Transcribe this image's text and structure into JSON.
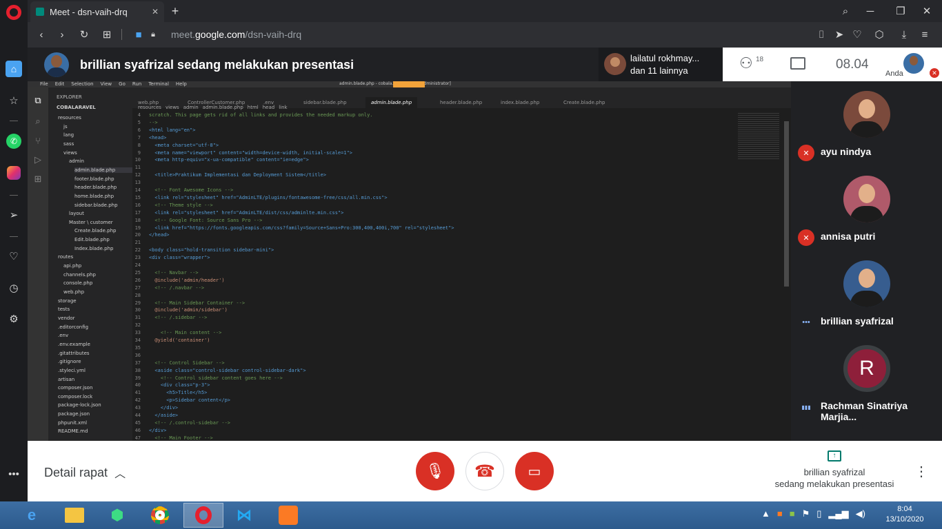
{
  "browser": {
    "tab_title": "Meet - dsn-vaih-drq",
    "address_prefix": "meet.",
    "address_domain": "google.com",
    "address_path": "/dsn-vaih-drq"
  },
  "meet": {
    "presenter_banner": "brillian syafrizal sedang melakukan presentasi",
    "others_name": "lailatul rokhmay...",
    "others_more": "dan 11 lainnya",
    "participants_count": "18",
    "time": "08.04",
    "self_label": "Anda",
    "participants": [
      {
        "name": "ayu nindya"
      },
      {
        "name": "annisa putri"
      },
      {
        "name": "brillian syafrizal"
      },
      {
        "name": "Rachman Sinatriya Marjia...",
        "initial": "R"
      }
    ],
    "details_label": "Detail rapat",
    "presenting_line1": "brillian syafrizal",
    "presenting_line2": "sedang melakukan presentasi"
  },
  "vscode": {
    "window_title": "admin.blade.php - cobala... udio Code [Administrator]",
    "menu": [
      "File",
      "Edit",
      "Selection",
      "View",
      "Go",
      "Run",
      "Terminal",
      "Help"
    ],
    "explorer_title": "EXPLORER",
    "project": "COBALARAVEL",
    "tabs": [
      "web.php",
      "ControllerCustomer.php",
      ".env",
      "sidebar.blade.php",
      "admin.blade.php",
      "header.blade.php",
      "index.blade.php",
      "Create.blade.php"
    ],
    "breadcrumb": [
      "resources",
      "views",
      "admin",
      "admin.blade.php",
      "html",
      "head",
      "link"
    ],
    "tree": [
      "resources",
      "js",
      "lang",
      "sass",
      "views",
      "admin",
      "admin.blade.php",
      "footer.blade.php",
      "header.blade.php",
      "home.blade.php",
      "sidebar.blade.php",
      "layout",
      "Master \\ customer",
      "Create.blade.php",
      "Edit.blade.php",
      "Index.blade.php",
      "routes",
      "api.php",
      "channels.php",
      "console.php",
      "web.php",
      "storage",
      "tests",
      "vendor",
      ".editorconfig",
      ".env",
      ".env.example",
      ".gitattributes",
      ".gitignore",
      ".styleci.yml",
      "artisan",
      "composer.json",
      "composer.lock",
      "package-lock.json",
      "package.json",
      "phpunit.xml",
      "README.md"
    ],
    "code": [
      {
        "n": "4",
        "t": "scratch. This page gets rid of all links and provides the needed markup only."
      },
      {
        "n": "5",
        "t": "-->"
      },
      {
        "n": "6",
        "t": "<html lang=\"en\">"
      },
      {
        "n": "7",
        "t": "<head>"
      },
      {
        "n": "8",
        "t": "  <meta charset=\"utf-8\">"
      },
      {
        "n": "9",
        "t": "  <meta name=\"viewport\" content=\"width=device-width, initial-scale=1\">"
      },
      {
        "n": "10",
        "t": "  <meta http-equiv=\"x-ua-compatible\" content=\"ie=edge\">"
      },
      {
        "n": "11",
        "t": ""
      },
      {
        "n": "12",
        "t": "  <title>Praktikum Implementasi dan Deployment Sistem</title>"
      },
      {
        "n": "13",
        "t": ""
      },
      {
        "n": "14",
        "t": "  <!-- Font Awesome Icons -->"
      },
      {
        "n": "15",
        "t": "  <link rel=\"stylesheet\" href=\"AdminLTE/plugins/fontawesome-free/css/all.min.css\">"
      },
      {
        "n": "16",
        "t": "  <!-- Theme style -->"
      },
      {
        "n": "17",
        "t": "  <link rel=\"stylesheet\" href=\"AdminLTE/dist/css/adminlte.min.css\">"
      },
      {
        "n": "18",
        "t": "  <!-- Google Font: Source Sans Pro -->"
      },
      {
        "n": "19",
        "t": "  <link href=\"https://fonts.googleapis.com/css?family=Source+Sans+Pro:300,400,400i,700\" rel=\"stylesheet\">"
      },
      {
        "n": "20",
        "t": "</head>"
      },
      {
        "n": "21",
        "t": ""
      },
      {
        "n": "22",
        "t": "<body class=\"hold-transition sidebar-mini\">"
      },
      {
        "n": "23",
        "t": "<div class=\"wrapper\">"
      },
      {
        "n": "24",
        "t": ""
      },
      {
        "n": "25",
        "t": "  <!-- Navbar -->"
      },
      {
        "n": "26",
        "t": "  @include('admin/header')"
      },
      {
        "n": "27",
        "t": "  <!-- /.navbar -->"
      },
      {
        "n": "28",
        "t": ""
      },
      {
        "n": "29",
        "t": "  <!-- Main Sidebar Container -->"
      },
      {
        "n": "30",
        "t": "  @include('admin/sidebar')"
      },
      {
        "n": "31",
        "t": "  <!-- /.sidebar -->"
      },
      {
        "n": "32",
        "t": ""
      },
      {
        "n": "33",
        "t": "    <!-- Main content -->"
      },
      {
        "n": "34",
        "t": "  @yield('container')"
      },
      {
        "n": "35",
        "t": ""
      },
      {
        "n": "36",
        "t": ""
      },
      {
        "n": "37",
        "t": "  <!-- Control Sidebar -->"
      },
      {
        "n": "38",
        "t": "  <aside class=\"control-sidebar control-sidebar-dark\">"
      },
      {
        "n": "39",
        "t": "    <!-- Control sidebar content goes here -->"
      },
      {
        "n": "40",
        "t": "    <div class=\"p-3\">"
      },
      {
        "n": "41",
        "t": "      <h5>Title</h5>"
      },
      {
        "n": "42",
        "t": "      <p>Sidebar content</p>"
      },
      {
        "n": "43",
        "t": "    </div>"
      },
      {
        "n": "44",
        "t": "  </aside>"
      },
      {
        "n": "45",
        "t": "  <!-- /.control-sidebar -->"
      },
      {
        "n": "46",
        "t": "</div>"
      },
      {
        "n": "47",
        "t": "  <!-- Main Footer -->"
      }
    ]
  },
  "taskbar": {
    "clock_time": "8:04",
    "clock_date": "13/10/2020"
  },
  "colors": {
    "meet_red": "#d93025",
    "meet_dark": "#202124",
    "vscode_bg": "#1e1e1e",
    "accent_blue": "#1a73e8"
  }
}
